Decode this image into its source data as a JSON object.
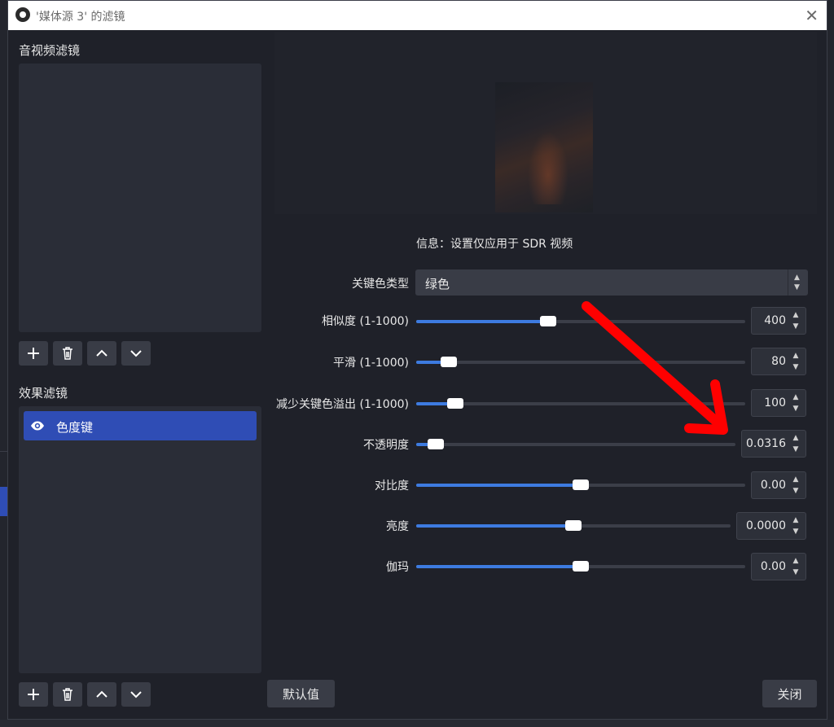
{
  "window": {
    "title": "'媒体源 3' 的滤镜",
    "close_glyph": "✕"
  },
  "audio_filters": {
    "label": "音视频滤镜"
  },
  "effect_filters": {
    "label": "效果滤镜",
    "items": [
      {
        "label": "色度键",
        "icon": "eye-icon"
      }
    ]
  },
  "toolbar_icons": {
    "add": "plus-icon",
    "remove": "trash-icon",
    "up": "chevron-up-icon",
    "down": "chevron-down-icon"
  },
  "info": "信息：设置仅应用于 SDR 视频",
  "properties": {
    "key_color_type": {
      "label": "关键色类型",
      "value": "绿色"
    },
    "similarity": {
      "label": "相似度 (1-1000)",
      "value": "400",
      "level": 0.4
    },
    "smoothness": {
      "label": "平滑 (1-1000)",
      "value": "80",
      "level": 0.1
    },
    "spill": {
      "label": "减少关键色溢出 (1-1000)",
      "value": "100",
      "level": 0.12
    },
    "opacity": {
      "label": "不透明度",
      "value": "0.0316",
      "level": 0.06
    },
    "contrast": {
      "label": "对比度",
      "value": "0.00",
      "level": 0.5
    },
    "brightness": {
      "label": "亮度",
      "value": "0.0000",
      "level": 0.5
    },
    "gamma": {
      "label": "伽玛",
      "value": "0.00",
      "level": 0.5
    }
  },
  "buttons": {
    "defaults": "默认值",
    "close": "关闭"
  },
  "colors": {
    "accent": "#3d7be0",
    "selection": "#2f4db5",
    "annotation": "#ff0000"
  }
}
